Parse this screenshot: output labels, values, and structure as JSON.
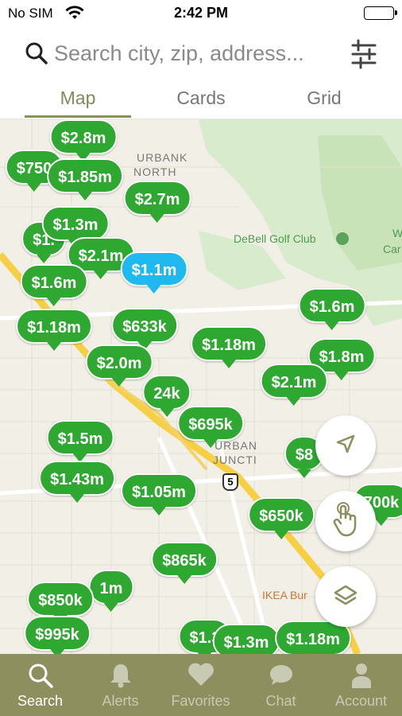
{
  "status_bar": {
    "carrier": "No SIM",
    "time": "2:42 PM"
  },
  "search": {
    "placeholder": "Search city, zip, address..."
  },
  "tabs": [
    {
      "label": "Map",
      "active": true
    },
    {
      "label": "Cards",
      "active": false
    },
    {
      "label": "Grid",
      "active": false
    }
  ],
  "map": {
    "labels": {
      "area1": "URBANK",
      "area2": "NORTH",
      "golf": "DeBell Golf Club",
      "edge": "W",
      "edge2": "Car",
      "junction1": "URBAN",
      "junction2": "JUNCTI",
      "ikea": "IKEA Bur",
      "highway": "5"
    },
    "pins": [
      {
        "price": "$2.8m",
        "color": "green"
      },
      {
        "price": "$750",
        "color": "green"
      },
      {
        "price": "$1.85m",
        "color": "green"
      },
      {
        "price": "$2.7m",
        "color": "green"
      },
      {
        "price": "$1.3m",
        "color": "green"
      },
      {
        "price": "$1.",
        "color": "green"
      },
      {
        "price": "$2.1m",
        "color": "green"
      },
      {
        "price": "$1.1m",
        "color": "blue"
      },
      {
        "price": "$1.6m",
        "color": "green"
      },
      {
        "price": "$1.18m",
        "color": "green"
      },
      {
        "price": "$633k",
        "color": "green"
      },
      {
        "price": "$1.18m",
        "color": "green"
      },
      {
        "price": "$1.6m",
        "color": "green"
      },
      {
        "price": "$1.8m",
        "color": "green"
      },
      {
        "price": "$2.0m",
        "color": "green"
      },
      {
        "price": "$2.1m",
        "color": "green"
      },
      {
        "price": "24k",
        "color": "green"
      },
      {
        "price": "$695k",
        "color": "green"
      },
      {
        "price": "$1.5m",
        "color": "green"
      },
      {
        "price": "$1.43m",
        "color": "green"
      },
      {
        "price": "$1.05m",
        "color": "green"
      },
      {
        "price": "$650k",
        "color": "green"
      },
      {
        "price": "$8",
        "color": "green"
      },
      {
        "price": "700k",
        "color": "green"
      },
      {
        "price": "$865k",
        "color": "green"
      },
      {
        "price": "$850k",
        "color": "green"
      },
      {
        "price": "1m",
        "color": "green"
      },
      {
        "price": "$995k",
        "color": "green"
      },
      {
        "price": "$1.3",
        "color": "green"
      },
      {
        "price": "$1.3m",
        "color": "green"
      },
      {
        "price": "$1.18m",
        "color": "green"
      }
    ]
  },
  "buttons": {
    "locate": "navigation-arrow",
    "gesture": "hand-tap",
    "layers": "layers"
  },
  "bottom_nav": [
    {
      "label": "Search",
      "active": true
    },
    {
      "label": "Alerts",
      "active": false
    },
    {
      "label": "Favorites",
      "active": false
    },
    {
      "label": "Chat",
      "active": false
    },
    {
      "label": "Account",
      "active": false
    }
  ],
  "colors": {
    "accent": "#8d8f5e",
    "pin_green": "#2ea831",
    "pin_blue": "#1db9ef"
  }
}
